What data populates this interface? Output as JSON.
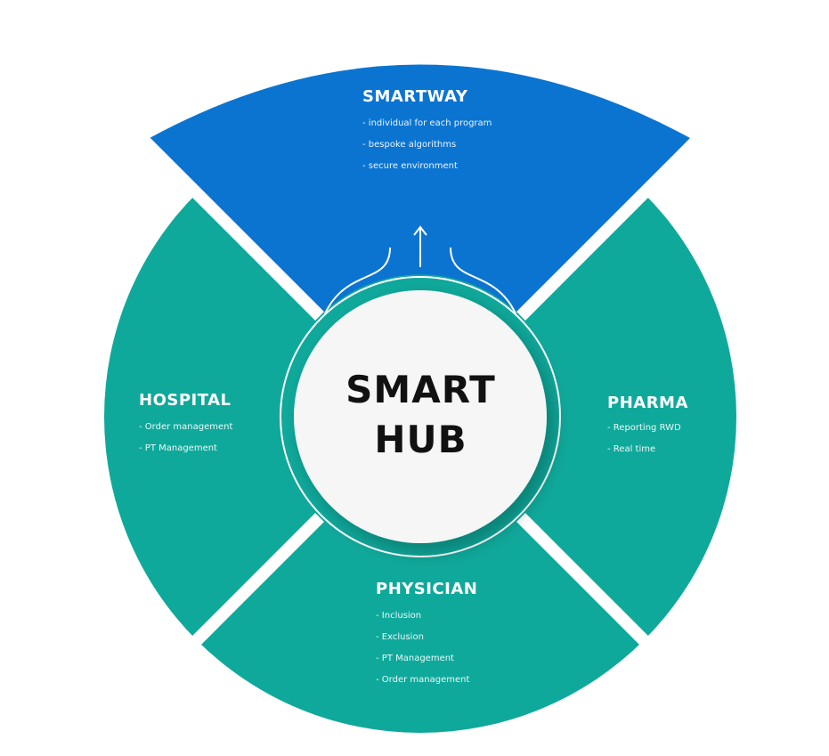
{
  "colors": {
    "blue": "#0b74d1",
    "teal": "#0fa99b",
    "white": "#ffffff"
  },
  "hub": {
    "line1": "SMART",
    "line2": "HUB"
  },
  "segments": {
    "smartway": {
      "title": "SMARTWAY",
      "items": [
        "- individual for each program",
        "- bespoke algorithms",
        "- secure environment"
      ]
    },
    "hospital": {
      "title": "HOSPITAL",
      "items": [
        "- Order management",
        "- PT Management"
      ]
    },
    "pharma": {
      "title": "PHARMA",
      "items": [
        "- Reporting RWD",
        "- Real time"
      ]
    },
    "physician": {
      "title": "PHYSICIAN",
      "items": [
        "- Inclusion",
        "- Exclusion",
        "- PT Management",
        "- Order management"
      ]
    }
  }
}
